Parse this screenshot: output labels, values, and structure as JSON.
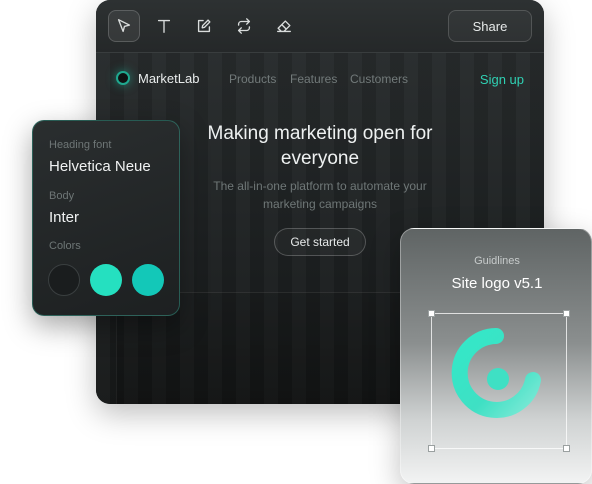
{
  "toolbar": {
    "tools": [
      "select-icon",
      "text-icon",
      "edit-icon",
      "repeat-icon",
      "eraser-icon"
    ],
    "share_label": "Share"
  },
  "site": {
    "brand": "MarketLab",
    "nav": [
      "Products",
      "Features",
      "Customers"
    ],
    "signup": "Sign up",
    "hero_title": "Making marketing open for everyone",
    "hero_subtitle": "The all-in-one platform to automate your marketing campaigns",
    "cta": "Get started"
  },
  "font_panel": {
    "heading_label": "Heading font",
    "heading_value": "Helvetica Neue",
    "body_label": "Body",
    "body_value": "Inter",
    "colors_label": "Colors",
    "colors": [
      "#1a1d1e",
      "#25e0c0",
      "#13c8b8"
    ]
  },
  "guidelines": {
    "label": "Guidlines",
    "title": "Site logo v5.1"
  },
  "theme": {
    "accent": "#2fd0b3"
  }
}
